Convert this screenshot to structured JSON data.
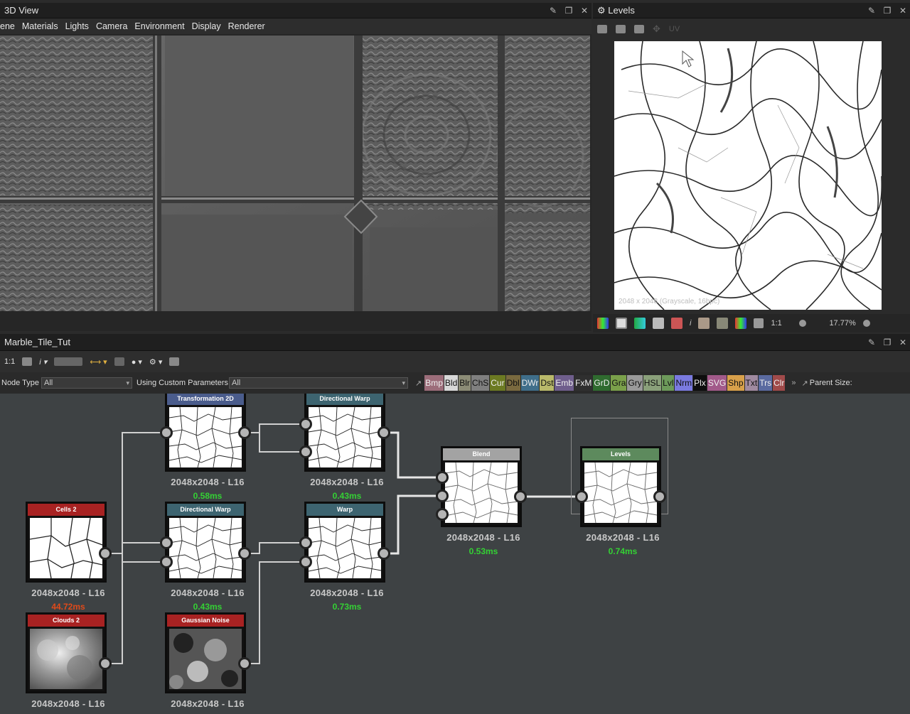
{
  "view3d": {
    "title": "3D View",
    "menu": [
      "ene",
      "Materials",
      "Lights",
      "Camera",
      "Environment",
      "Display",
      "Renderer"
    ]
  },
  "levels_panel": {
    "title": "Levels",
    "uv_label": "UV",
    "image_info": "2048 x 2048 (Grayscale, 16bpc)",
    "ratio_label": "1:1",
    "zoom": "17.77%"
  },
  "graph": {
    "title": "Marble_Tile_Tut",
    "toolbar_ratio": "1:1",
    "node_type_label": "Node Type",
    "node_type_value": "All",
    "params_label": "Using Custom Parameters",
    "params_value": "All",
    "parent_size_label": "Parent Size:",
    "more": "»",
    "tags": [
      {
        "label": "Bmp",
        "color": "#9c6d7a"
      },
      {
        "label": "Bld",
        "color": "#d8d8d8"
      },
      {
        "label": "Blr",
        "color": "#8c8c76"
      },
      {
        "label": "ChS",
        "color": "#7f7f7f"
      },
      {
        "label": "Cur",
        "color": "#6c7a22"
      },
      {
        "label": "Dbl",
        "color": "#7a6a3f"
      },
      {
        "label": "DWr",
        "color": "#3f6e8a"
      },
      {
        "label": "Dst",
        "color": "#b9b96a"
      },
      {
        "label": "Emb",
        "color": "#6f5e8c"
      },
      {
        "label": "FxM",
        "color": "#2f2f2f"
      },
      {
        "label": "GrD",
        "color": "#2f6b2f"
      },
      {
        "label": "Gra",
        "color": "#7aa04a"
      },
      {
        "label": "Gry",
        "color": "#9a9a9a"
      },
      {
        "label": "HSL",
        "color": "#8aa07a"
      },
      {
        "label": "Lvl",
        "color": "#6d9a5a"
      },
      {
        "label": "Nrm",
        "color": "#7a7ae0"
      },
      {
        "label": "Plx",
        "color": "#0e0e0e"
      },
      {
        "label": "SVG",
        "color": "#a25a8a"
      },
      {
        "label": "Shp",
        "color": "#d8a04a"
      },
      {
        "label": "Txt",
        "color": "#a08aa0"
      },
      {
        "label": "Trs",
        "color": "#5a6aa0"
      },
      {
        "label": "Clr",
        "color": "#a04a4a"
      }
    ],
    "nodes": [
      {
        "id": "transform2d",
        "title": "Transformation 2D",
        "color": "#4a5c8c",
        "res": "2048x2048 - L16",
        "time": "0.58ms"
      },
      {
        "id": "dirwarp1",
        "title": "Directional Warp",
        "color": "#3d6470",
        "res": "2048x2048 - L16",
        "time": "0.43ms"
      },
      {
        "id": "blend",
        "title": "Blend",
        "color": "#a3a3a3",
        "res": "2048x2048 - L16",
        "time": "0.53ms"
      },
      {
        "id": "levels",
        "title": "Levels",
        "color": "#5d8a5d",
        "res": "2048x2048 - L16",
        "time": "0.74ms"
      },
      {
        "id": "cells2",
        "title": "Cells 2",
        "color": "#a82222",
        "res": "2048x2048 - L16",
        "time": "44.72ms",
        "time_color": "#e04a1a"
      },
      {
        "id": "dirwarp2",
        "title": "Directional Warp",
        "color": "#3d6470",
        "res": "2048x2048 - L16",
        "time": "0.43ms"
      },
      {
        "id": "warp",
        "title": "Warp",
        "color": "#3d6470",
        "res": "2048x2048 - L16",
        "time": "0.73ms"
      },
      {
        "id": "clouds2",
        "title": "Clouds 2",
        "color": "#a82222",
        "res": "2048x2048 - L16",
        "time": ""
      },
      {
        "id": "gaussian",
        "title": "Gaussian Noise",
        "color": "#a82222",
        "res": "2048x2048 - L16",
        "time": ""
      }
    ]
  }
}
